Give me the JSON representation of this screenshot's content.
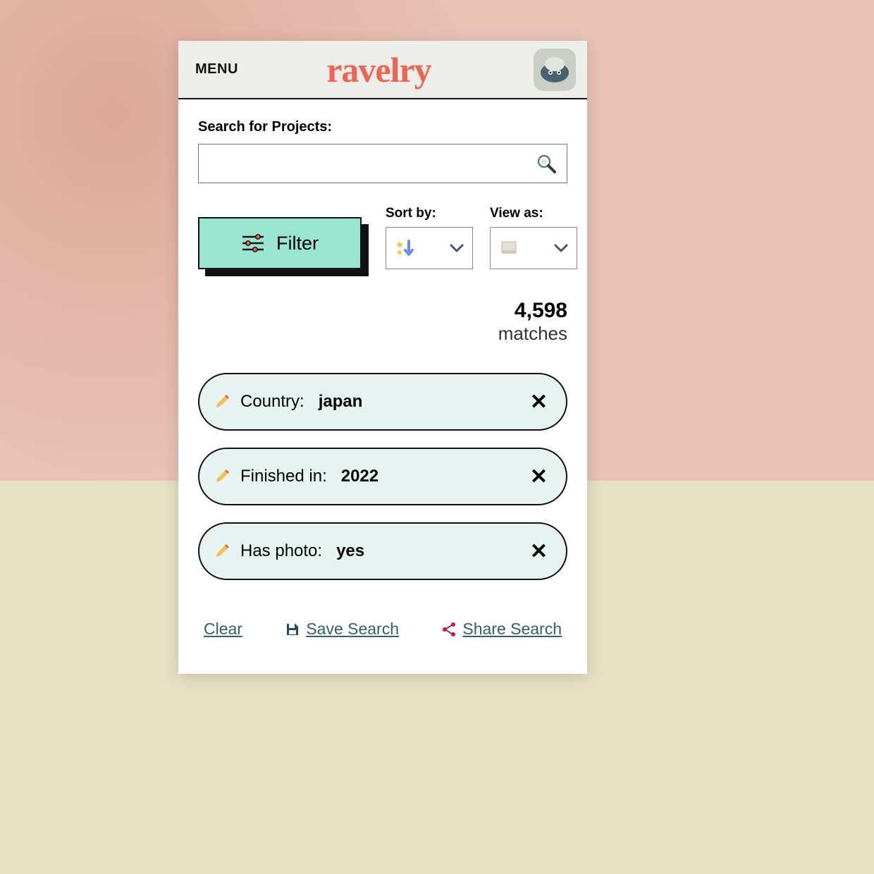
{
  "header": {
    "menu_label": "MENU",
    "logo_text": "ravelry"
  },
  "search": {
    "label": "Search for Projects:",
    "value": ""
  },
  "controls": {
    "filter_label": "Filter",
    "sort_label": "Sort by:",
    "view_label": "View as:"
  },
  "results": {
    "count": "4,598",
    "word": "matches"
  },
  "chips": [
    {
      "label": "Country:",
      "value": "japan"
    },
    {
      "label": "Finished in:",
      "value": "2022"
    },
    {
      "label": "Has photo:",
      "value": "yes"
    }
  ],
  "actions": {
    "clear": "Clear",
    "save": "Save Search",
    "share": "Share Search"
  }
}
